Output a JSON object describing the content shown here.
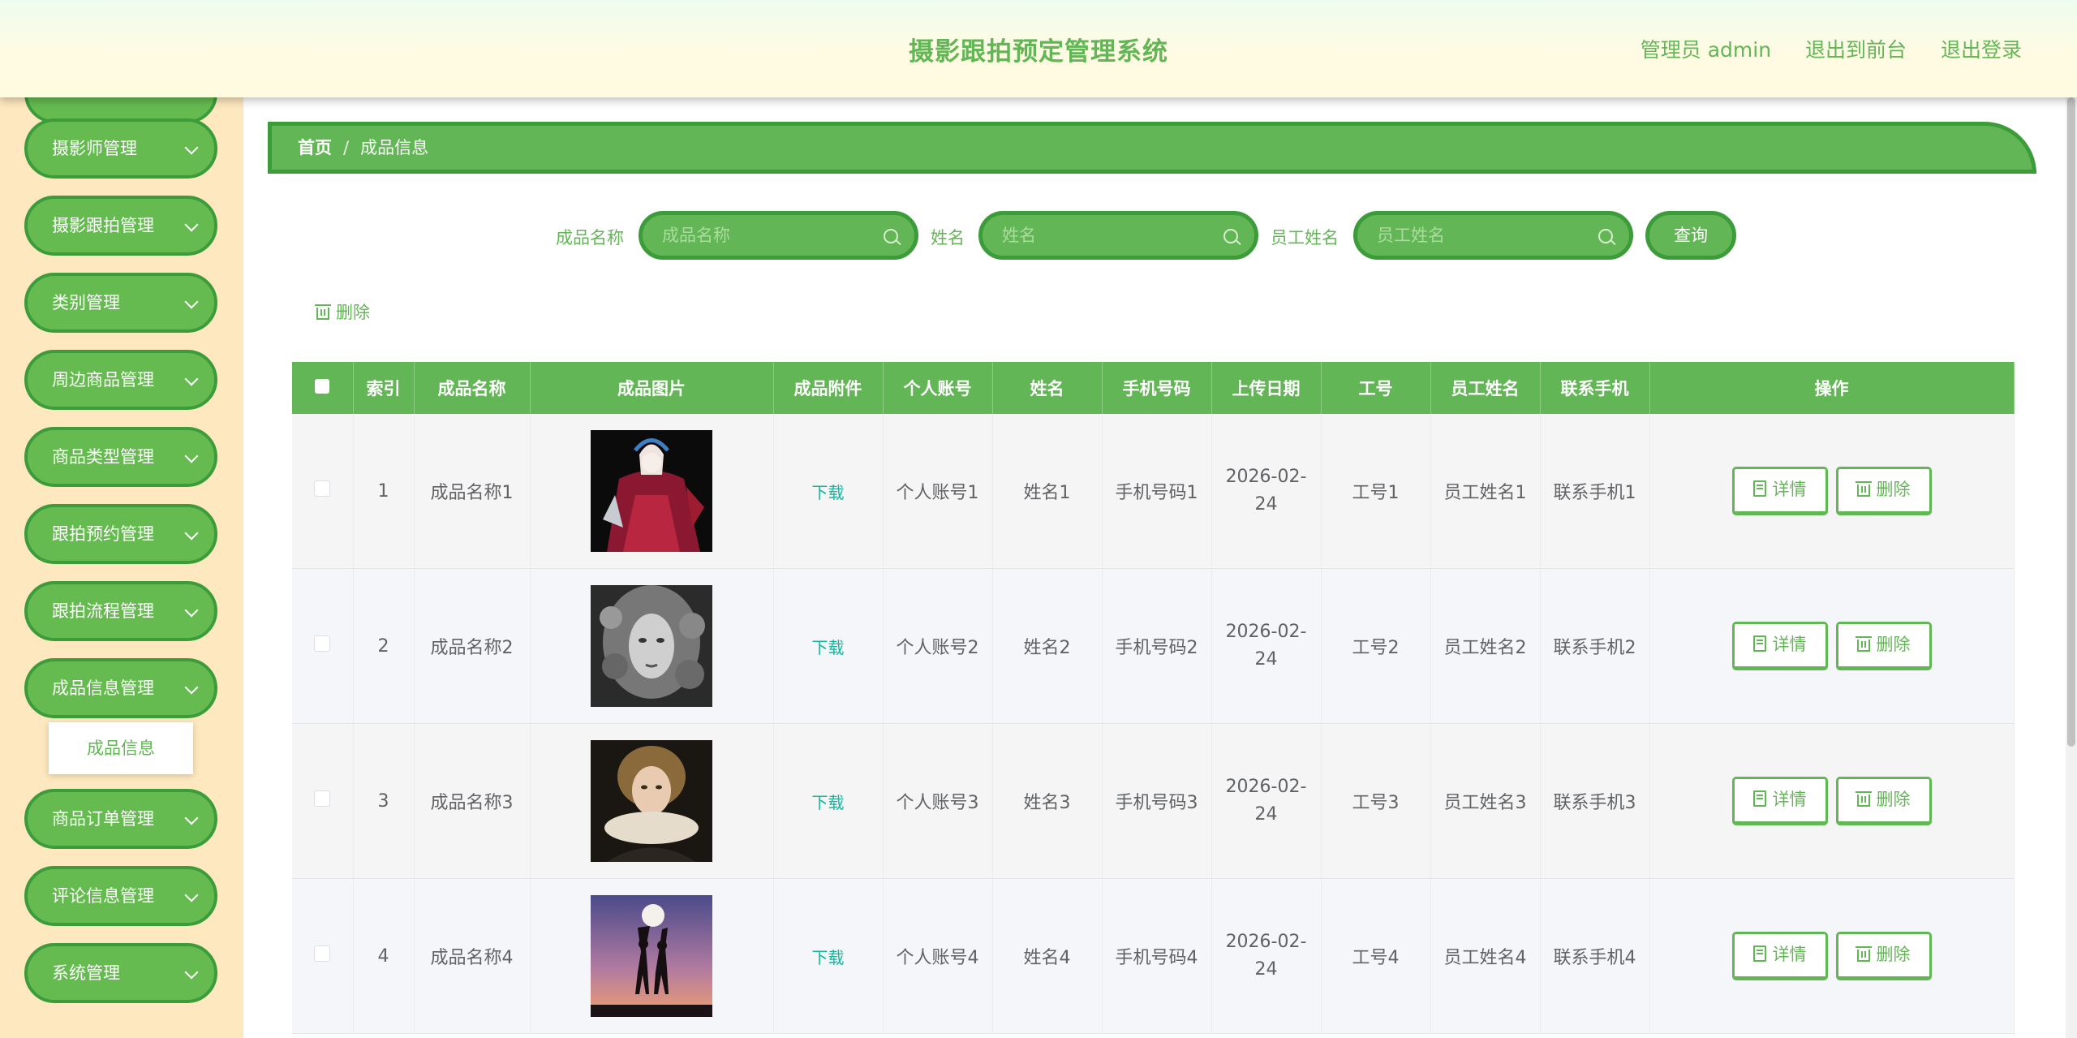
{
  "header": {
    "title": "摄影跟拍预定管理系统",
    "user_label": "管理员 admin",
    "front_link": "退出到前台",
    "logout_link": "退出登录"
  },
  "sidebar": {
    "items": [
      {
        "label": "摄影师管理"
      },
      {
        "label": "摄影跟拍管理"
      },
      {
        "label": "类别管理"
      },
      {
        "label": "周边商品管理"
      },
      {
        "label": "商品类型管理"
      },
      {
        "label": "跟拍预约管理"
      },
      {
        "label": "跟拍流程管理"
      },
      {
        "label": "成品信息管理"
      },
      {
        "label": "商品订单管理"
      },
      {
        "label": "评论信息管理"
      },
      {
        "label": "系统管理"
      }
    ],
    "active_submenu": "成品信息"
  },
  "breadcrumb": {
    "home": "首页",
    "separator": "/",
    "current": "成品信息"
  },
  "search": {
    "name_label": "成品名称",
    "name_placeholder": "成品名称",
    "xingming_label": "姓名",
    "xingming_placeholder": "姓名",
    "employee_label": "员工姓名",
    "employee_placeholder": "员工姓名",
    "query_button": "查询"
  },
  "toolbar": {
    "batch_delete": "删除"
  },
  "table": {
    "headers": [
      "索引",
      "成品名称",
      "成品图片",
      "成品附件",
      "个人账号",
      "姓名",
      "手机号码",
      "上传日期",
      "工号",
      "员工姓名",
      "联系手机",
      "操作"
    ],
    "download_label": "下载",
    "detail_label": "详情",
    "delete_label": "删除",
    "rows": [
      {
        "index": "1",
        "name": "成品名称1",
        "account": "个人账号1",
        "xingming": "姓名1",
        "phone": "手机号码1",
        "date": "2026-02-24",
        "job_no": "工号1",
        "employee": "员工姓名1",
        "contact": "联系手机1"
      },
      {
        "index": "2",
        "name": "成品名称2",
        "account": "个人账号2",
        "xingming": "姓名2",
        "phone": "手机号码2",
        "date": "2026-02-24",
        "job_no": "工号2",
        "employee": "员工姓名2",
        "contact": "联系手机2"
      },
      {
        "index": "3",
        "name": "成品名称3",
        "account": "个人账号3",
        "xingming": "姓名3",
        "phone": "手机号码3",
        "date": "2026-02-24",
        "job_no": "工号3",
        "employee": "员工姓名3",
        "contact": "联系手机3"
      },
      {
        "index": "4",
        "name": "成品名称4",
        "account": "个人账号4",
        "xingming": "姓名4",
        "phone": "手机号码4",
        "date": "2026-02-24",
        "job_no": "工号4",
        "employee": "员工姓名4",
        "contact": "联系手机4"
      }
    ]
  },
  "colors": {
    "accent": "#63b655",
    "accent_dark": "#3d9c3a",
    "sidebar_bg": "#fde8bf",
    "link_teal": "#16b6a0"
  }
}
